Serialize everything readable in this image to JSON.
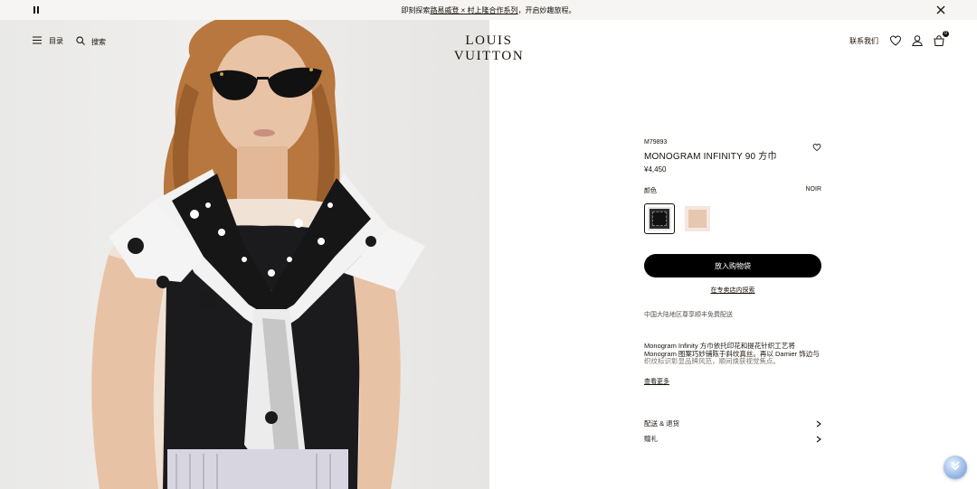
{
  "announcement": {
    "prefix": "即刻探索",
    "link": "路易威登 × 村上隆合作系列",
    "suffix": "，开启妙趣旅程。"
  },
  "header": {
    "menu_label": "目录",
    "search_label": "搜索",
    "logo": "LOUIS VUITTON",
    "contact_label": "联系我们",
    "bag_count": "0"
  },
  "product": {
    "sku": "M79893",
    "name": "MONOGRAM INFINITY 90 方巾",
    "price": "¥4,450",
    "color_label": "颜色",
    "color_value": "NOIR",
    "swatches": [
      {
        "name": "NOIR",
        "selected": true
      },
      {
        "name": "beige",
        "selected": false
      }
    ],
    "add_to_bag": "放入购物袋",
    "find_in_store": "在专卖店内探索",
    "shipping_note": "中国大陆地区尊享顺丰免费配送",
    "description_line1": "Monogram Infinity 方巾依托印花和提花针织工艺将",
    "description_line2": "Monogram 图案巧妙铺陈于斜纹真丝。再以 Damier 饰边与",
    "description_line3": "织纹标识彰显品牌风范，顺间焕获视觉焦点。",
    "read_more": "查看更多",
    "links": [
      "配送 & 退货",
      "赠礼"
    ]
  },
  "colors": {
    "text": "#19110b",
    "button_bg": "#000000",
    "announce_bg": "#f6f5f3"
  }
}
